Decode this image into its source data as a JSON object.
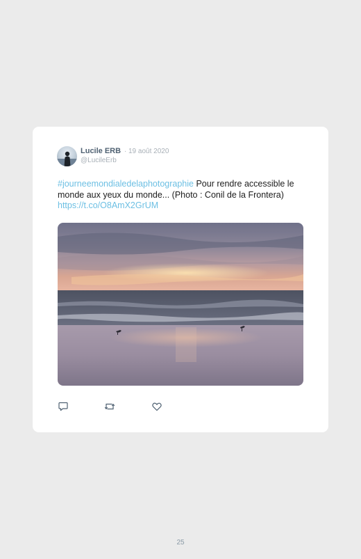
{
  "tweet": {
    "author_name": "Lucile ERB",
    "separator": "·",
    "date": "19 août 2020",
    "handle": "@LucileErb",
    "hashtag": "#journeemondialedelaphotographie",
    "text_body": " Pour rendre accessible le monde aux yeux du monde... (Photo : Conil de la Frontera) ",
    "short_link": "https://t.co/O8AmX2GrUM",
    "photo_subject": "sunset over beach with seagulls",
    "actions": [
      {
        "icon": "reply-icon"
      },
      {
        "icon": "retweet-icon"
      },
      {
        "icon": "like-icon"
      }
    ]
  },
  "footer": {
    "page_number": "25"
  },
  "colors": {
    "page_background": "#ebebeb",
    "card_background": "#ffffff",
    "link": "#6cbfe3",
    "author": "#4f6172",
    "muted": "#a8b0b7"
  }
}
